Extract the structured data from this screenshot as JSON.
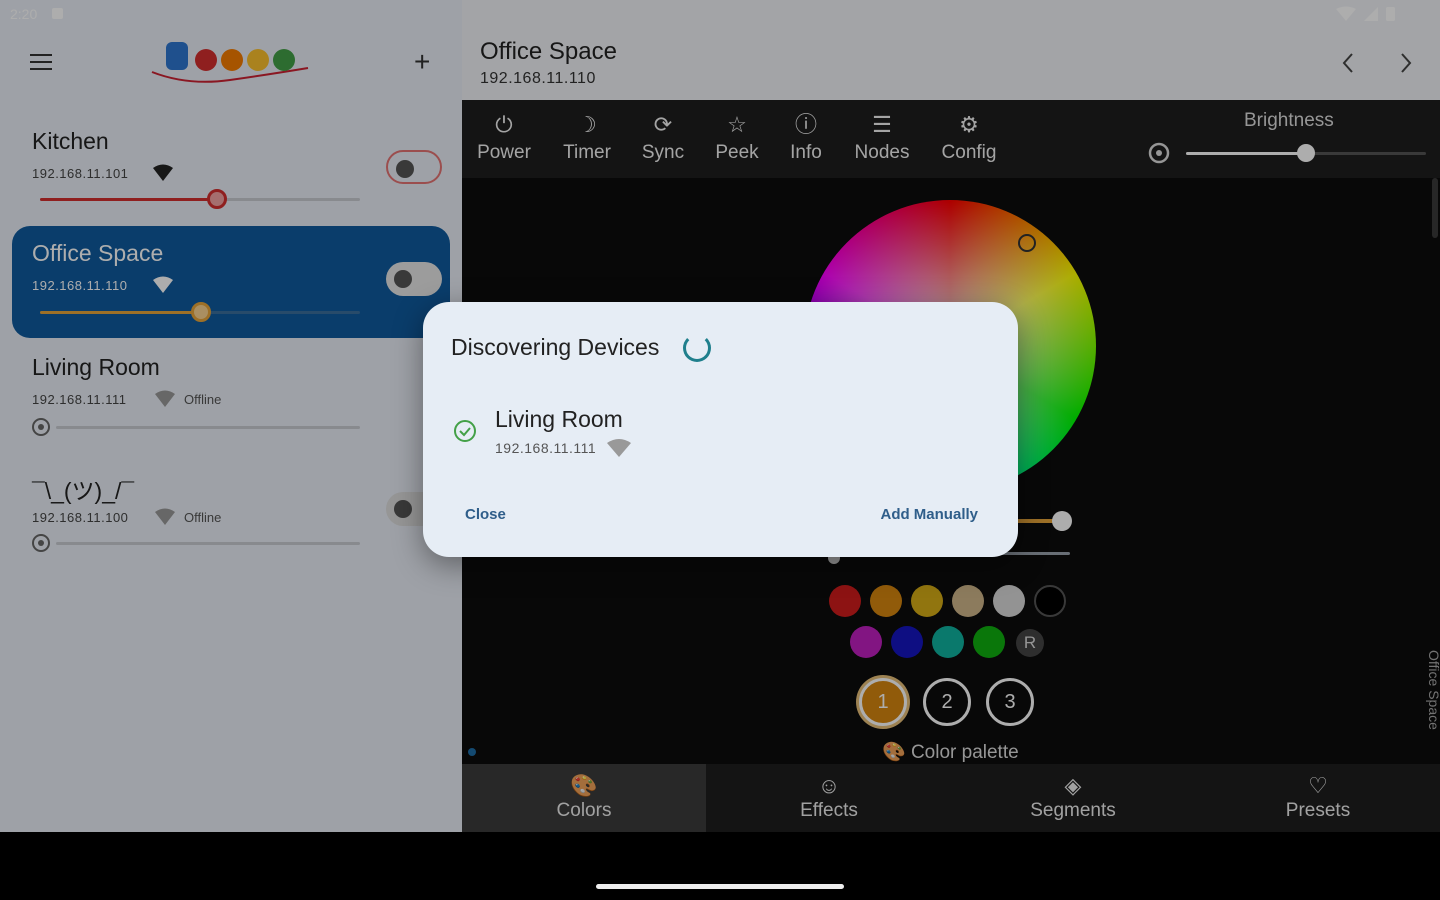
{
  "status": {
    "time": "2:20"
  },
  "sidebar": {
    "devices": [
      {
        "name": "Kitchen",
        "address": "192.168.11.101",
        "online": true,
        "brightness": 0.55,
        "accent": "#d32f2f"
      },
      {
        "name": "Office Space",
        "address": "192.168.11.110",
        "online": true,
        "selected": true,
        "brightness": 0.5,
        "accent": "#e8a53a"
      },
      {
        "name": "Living Room",
        "address": "192.168.11.111",
        "online": false,
        "status": "Offline"
      },
      {
        "name": "¯\\_(ツ)_/¯",
        "address": "192.168.11.100",
        "online": false,
        "status": "Offline"
      }
    ]
  },
  "header": {
    "title": "Office Space",
    "address": "192.168.11.110"
  },
  "toolbar": {
    "items": [
      {
        "label": "Power",
        "icon": "power-icon"
      },
      {
        "label": "Timer",
        "icon": "moon-icon"
      },
      {
        "label": "Sync",
        "icon": "sync-icon"
      },
      {
        "label": "Peek",
        "icon": "star-icon"
      },
      {
        "label": "Info",
        "icon": "info-icon"
      },
      {
        "label": "Nodes",
        "icon": "list-icon"
      },
      {
        "label": "Config",
        "icon": "gear-icon"
      }
    ],
    "brightness_label": "Brightness",
    "brightness_value": 0.5
  },
  "colors": {
    "swatches_row1": [
      "#d01c1c",
      "#d6860f",
      "#d6ad17",
      "#cfb68a",
      "#d9d9d9",
      "#000000"
    ],
    "swatches_row2": [
      "#c020c0",
      "#1515c0",
      "#10b3a0",
      "#10b010"
    ],
    "random_label": "R",
    "slots": [
      "1",
      "2",
      "3"
    ],
    "palette_label": "Color palette",
    "side_label": "Office Space"
  },
  "tabs": [
    {
      "label": "Colors",
      "icon": "palette-icon",
      "active": true
    },
    {
      "label": "Effects",
      "icon": "smile-icon"
    },
    {
      "label": "Segments",
      "icon": "layers-icon"
    },
    {
      "label": "Presets",
      "icon": "heart-icon"
    }
  ],
  "dialog": {
    "title": "Discovering Devices",
    "device_name": "Living Room",
    "device_address": "192.168.11.111",
    "close_label": "Close",
    "add_label": "Add Manually"
  }
}
